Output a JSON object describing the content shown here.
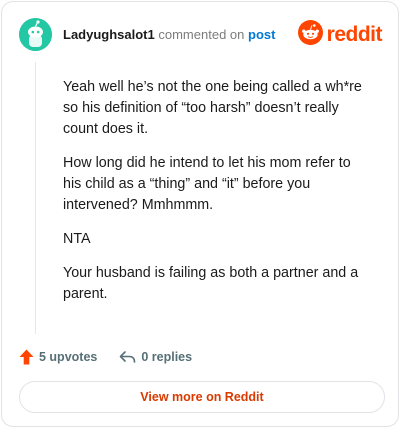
{
  "comment": {
    "username": "Ladyughsalot1",
    "action_text": "commented on",
    "post_link_label": "post",
    "paragraphs": [
      "Yeah well he’s not the one being called a wh*re so his definition of “too harsh” doesn’t really count does it.",
      "How long did he intend to let his mom refer to his child as a “thing” and “it” before you intervened? Mmhmmm.",
      "NTA",
      "Your husband is failing as both a partner and a parent."
    ]
  },
  "brand": {
    "name": "reddit",
    "color": "#ff4500"
  },
  "actions": {
    "upvotes_label": "5 upvotes",
    "replies_label": "0 replies"
  },
  "view_button_label": "View more on Reddit",
  "icons": {
    "avatar": "snoo-avatar-icon",
    "brand": "reddit-logo-icon",
    "upvote": "upvote-arrow-icon",
    "reply": "reply-arrow-icon"
  }
}
